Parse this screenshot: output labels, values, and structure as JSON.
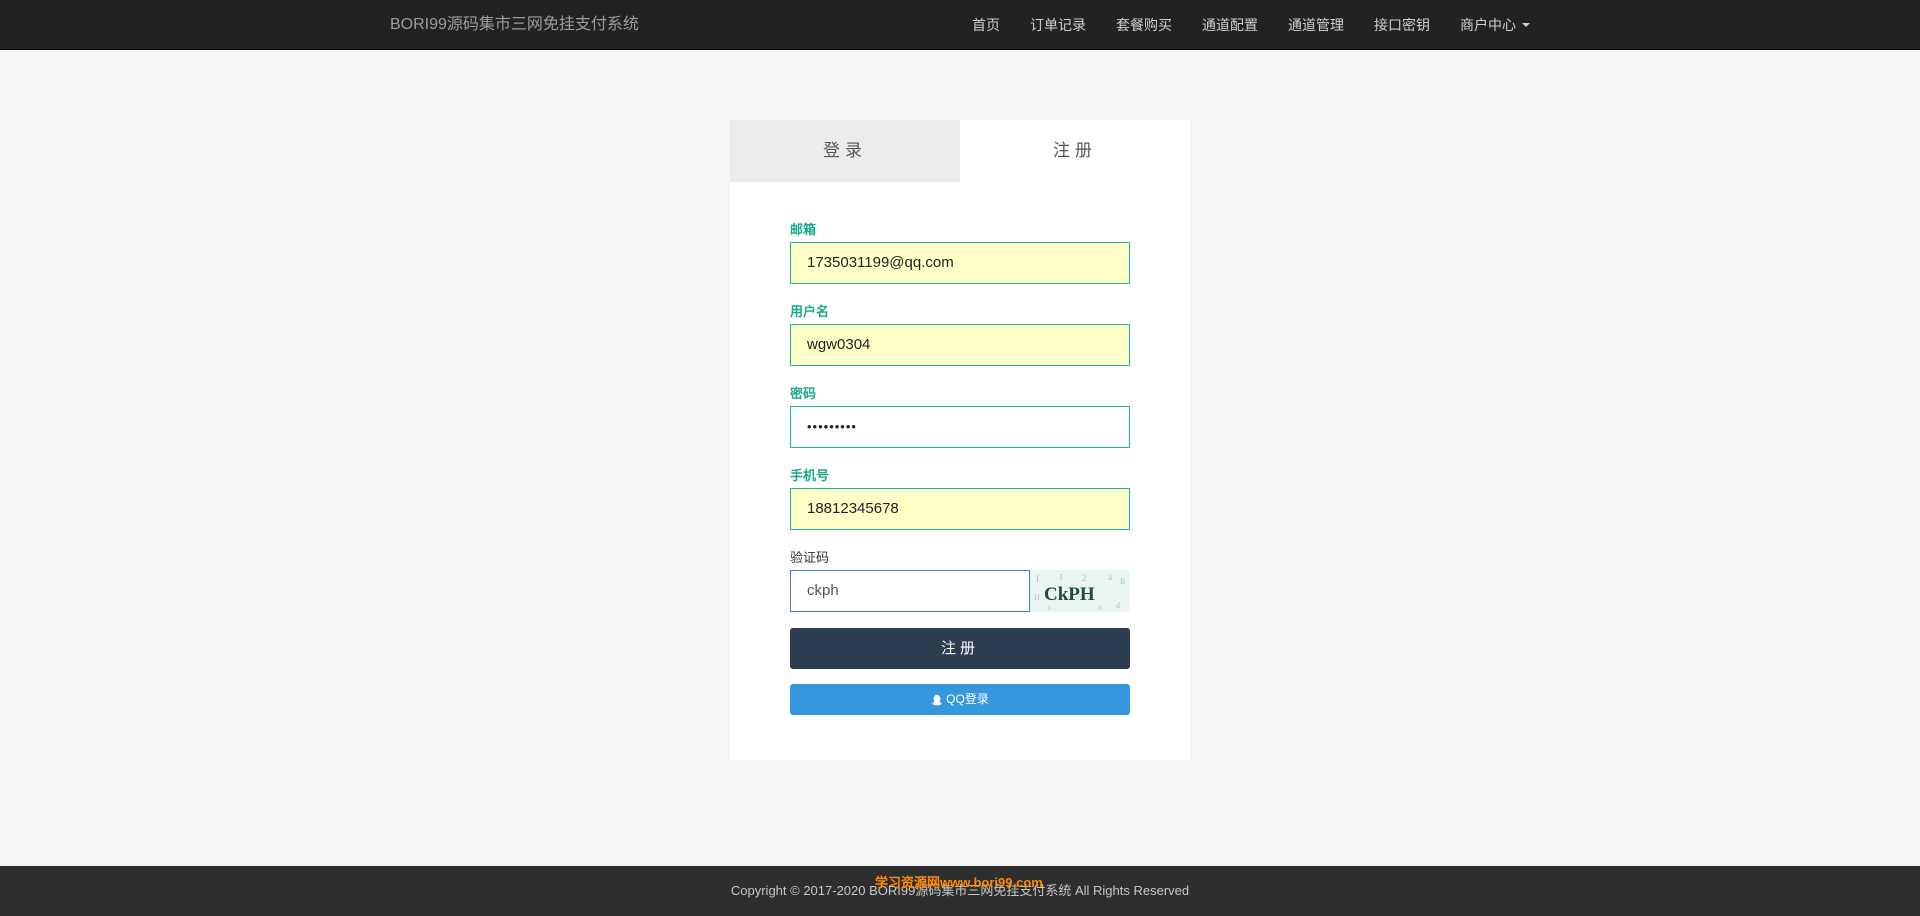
{
  "navbar": {
    "brand": "BORI99源码集市三网免挂支付系统",
    "items": [
      {
        "label": "首页"
      },
      {
        "label": "订单记录"
      },
      {
        "label": "套餐购买"
      },
      {
        "label": "通道配置"
      },
      {
        "label": "通道管理"
      },
      {
        "label": "接口密钥"
      },
      {
        "label": "商户中心"
      }
    ]
  },
  "tabs": {
    "login": "登录",
    "register": "注册"
  },
  "form": {
    "email_label": "邮箱",
    "email_value": "1735031199@qq.com",
    "username_label": "用户名",
    "username_value": "wgw0304",
    "password_label": "密码",
    "password_value": "•••••••••",
    "phone_label": "手机号",
    "phone_value": "18812345678",
    "captcha_label": "验证码",
    "captcha_value": "ckph",
    "captcha_image_text": "CkPH",
    "submit_label": "注册",
    "qq_login_label": "QQ登录"
  },
  "footer": {
    "copyright": "Copyright © 2017-2020 BORI99源码集市三网免挂支付系统 All Rights Reserved",
    "watermark": "学习资源网www.bori99.com"
  },
  "colors": {
    "navbar_bg": "#222222",
    "accent_green": "#1ab394",
    "submit_bg": "#2c3e50",
    "qq_bg": "#3598dc",
    "autofill_bg": "#ffffc7"
  },
  "icons": {
    "qq": "qq-penguin-icon",
    "dropdown": "caret-down-icon"
  }
}
